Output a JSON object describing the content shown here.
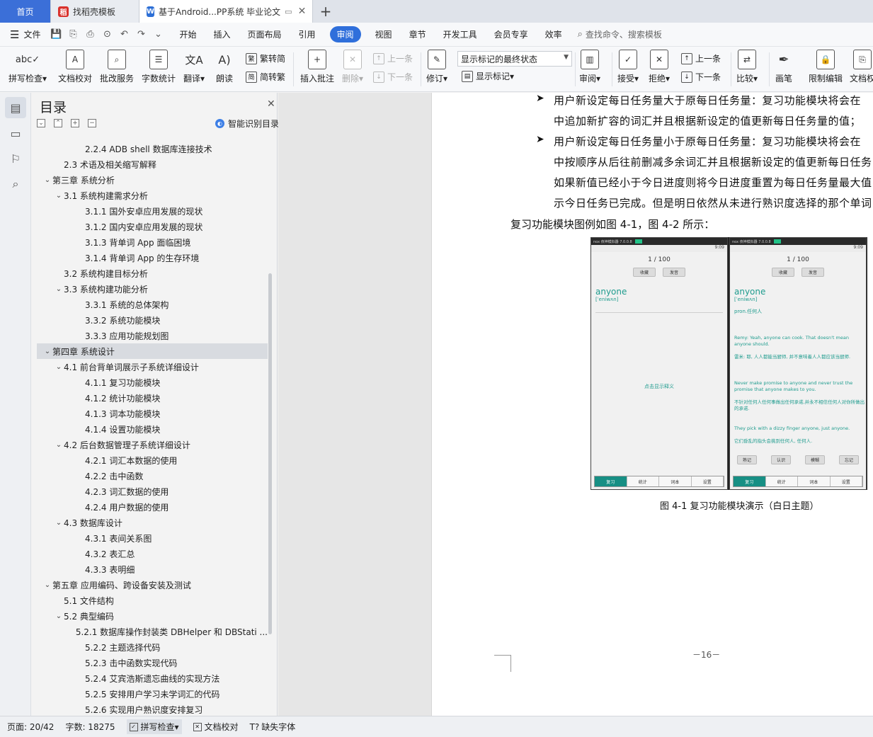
{
  "tabs": [
    {
      "label": "首页"
    },
    {
      "label": "找稻壳模板",
      "icon": "docer-icon"
    },
    {
      "label": "基于Android...PP系统 毕业论文",
      "icon": "wps-writer-icon"
    }
  ],
  "menu": {
    "file": "文件",
    "items": [
      "开始",
      "插入",
      "页面布局",
      "引用",
      "审阅",
      "视图",
      "章节",
      "开发工具",
      "会员专享",
      "效率"
    ],
    "active": "审阅",
    "search": "查找命令、搜索模板"
  },
  "ribbon": {
    "spell": "拼写检查",
    "doc_check": "文档校对",
    "batch": "批改服务",
    "word_count": "字数统计",
    "translate": "翻译",
    "read": "朗读",
    "trad": "繁转简",
    "simp": "简转繁",
    "insert_comment": "插入批注",
    "delete": "删除",
    "prev": "上一条",
    "next": "下一条",
    "revise": "修订",
    "markup_state": "显示标记的最终状态",
    "show_markup": "显示标记",
    "review": "审阅",
    "accept": "接受",
    "reject": "拒绝",
    "prev2": "上一条",
    "next2": "下一条",
    "compare": "比较",
    "pen": "画笔",
    "restrict": "限制编辑",
    "doc_rights": "文档权"
  },
  "toc": {
    "title": "目录",
    "smart": "智能识别目录",
    "items": [
      {
        "text": "2.2.4 ADB shell 数据库连接技术",
        "level": 3,
        "chev": ""
      },
      {
        "text": "2.3    术语及相关缩写解释",
        "level": 2,
        "chev": ""
      },
      {
        "text": "第三章  系统分析",
        "level": 1,
        "chev": "v"
      },
      {
        "text": "3.1    系统构建需求分析",
        "level": 2,
        "chev": "v"
      },
      {
        "text": "3.1.1  国外安卓应用发展的现状",
        "level": 3,
        "chev": ""
      },
      {
        "text": "3.1.2  国内安卓应用发展的现状",
        "level": 3,
        "chev": ""
      },
      {
        "text": "3.1.3  背单词 App 面临困境",
        "level": 3,
        "chev": ""
      },
      {
        "text": "3.1.4  背单词 App 的生存环境",
        "level": 3,
        "chev": ""
      },
      {
        "text": "3.2    系统构建目标分析",
        "level": 2,
        "chev": ""
      },
      {
        "text": "3.3    系统构建功能分析",
        "level": 2,
        "chev": "v"
      },
      {
        "text": "3.3.1  系统的总体架构",
        "level": 3,
        "chev": ""
      },
      {
        "text": "3.3.2  系统功能模块",
        "level": 3,
        "chev": ""
      },
      {
        "text": "3.3.3  应用功能规划图",
        "level": 3,
        "chev": ""
      },
      {
        "text": "第四章  系统设计",
        "level": 1,
        "chev": "v",
        "selected": true
      },
      {
        "text": "4.1    前台背单词展示子系统详细设计",
        "level": 2,
        "chev": "v"
      },
      {
        "text": "4.1.1  复习功能模块",
        "level": 3,
        "chev": ""
      },
      {
        "text": "4.1.2  统计功能模块",
        "level": 3,
        "chev": ""
      },
      {
        "text": "4.1.3  词本功能模块",
        "level": 3,
        "chev": ""
      },
      {
        "text": "4.1.4  设置功能模块",
        "level": 3,
        "chev": ""
      },
      {
        "text": "4.2    后台数据管理子系统详细设计",
        "level": 2,
        "chev": "v"
      },
      {
        "text": "4.2.1 词汇本数据的使用",
        "level": 3,
        "chev": ""
      },
      {
        "text": "4.2.2 击中函数",
        "level": 3,
        "chev": ""
      },
      {
        "text": "4.2.3 词汇数据的使用",
        "level": 3,
        "chev": ""
      },
      {
        "text": "4.2.4  用户数据的使用",
        "level": 3,
        "chev": ""
      },
      {
        "text": "4.3    数据库设计",
        "level": 2,
        "chev": "v"
      },
      {
        "text": "4.3.1  表间关系图",
        "level": 3,
        "chev": ""
      },
      {
        "text": "4.3.2  表汇总",
        "level": 3,
        "chev": ""
      },
      {
        "text": "4.3.3  表明细",
        "level": 3,
        "chev": ""
      },
      {
        "text": "第五章  应用编码、跨设备安装及测试",
        "level": 1,
        "chev": "v"
      },
      {
        "text": "5.1    文件结构",
        "level": 2,
        "chev": ""
      },
      {
        "text": "5.2    典型编码",
        "level": 2,
        "chev": "v"
      },
      {
        "text": "5.2.1  数据库操作封装类 DBHelper 和 DBStati ...",
        "level": 3,
        "chev": ""
      },
      {
        "text": "5.2.2  主题选择代码",
        "level": 3,
        "chev": ""
      },
      {
        "text": "5.2.3  击中函数实现代码",
        "level": 3,
        "chev": ""
      },
      {
        "text": "5.2.4  艾宾浩斯遗忘曲线的实现方法",
        "level": 3,
        "chev": ""
      },
      {
        "text": "5.2.5 安排用户学习未学词汇的代码",
        "level": 3,
        "chev": ""
      },
      {
        "text": "5.2.6  实现用户熟识度安排复习",
        "level": 3,
        "chev": ""
      }
    ]
  },
  "doc": {
    "lines": [
      "用户新设定每日任务量大于原每日任务量：复习功能模块将会在",
      "中追加新扩容的词汇并且根据新设定的值更新每日任务量的值；",
      "用户新设定每日任务量小于原每日任务量：复习功能模块将会在",
      "中按顺序从后往前删减多余词汇并且根据新设定的值更新每日任务",
      "如果新值已经小于今日进度则将今日进度重置为每日任务量最大值",
      "示今日任务已完成。但是明日依然从未进行熟识度选择的那个单词"
    ],
    "ref": "复习功能模块图例如图 4-1，图 4-2 所示：",
    "caption": "图 4-1  复习功能模块演示（白日主题）",
    "page_number": "－16－"
  },
  "phones": {
    "emulator": "nox 夜神模拟器 7.0.0.8",
    "time": "9:09",
    "progress": "1 / 100",
    "btn_collect": "收藏",
    "btn_sound": "发音",
    "word": "anyone",
    "phonetic": "[ˈeniwʌn]",
    "reveal": "点击显示释义",
    "definition": "pron.任何人",
    "ex1_en": "Remy: Yeah, anyone can cook. That doesn't mean anyone should.",
    "ex1_zh": "雷米: 耶, 人人都能当厨师, 并不意味着人人都应该当厨师.",
    "ex2_en": "Never make promise to anyone and never trust the promise that anyone makes to you.",
    "ex2_zh": "不针对任何人任何事做出任何承诺,并永不相信任何人对你所做出的承诺.",
    "ex3_en": "They pick with a dizzy finger anyone, just anyone.",
    "ex3_zh": "它们昏乱的指头会挑到任何人, 任何人.",
    "actions": [
      "熟记",
      "认识",
      "模糊",
      "忘记"
    ],
    "nav": [
      "复习",
      "统计",
      "词本",
      "设置"
    ]
  },
  "status": {
    "page": "页面: 20/42",
    "words": "字数: 18275",
    "spell": "拼写检查",
    "check": "文档校对",
    "missing_font": "缺失字体"
  }
}
